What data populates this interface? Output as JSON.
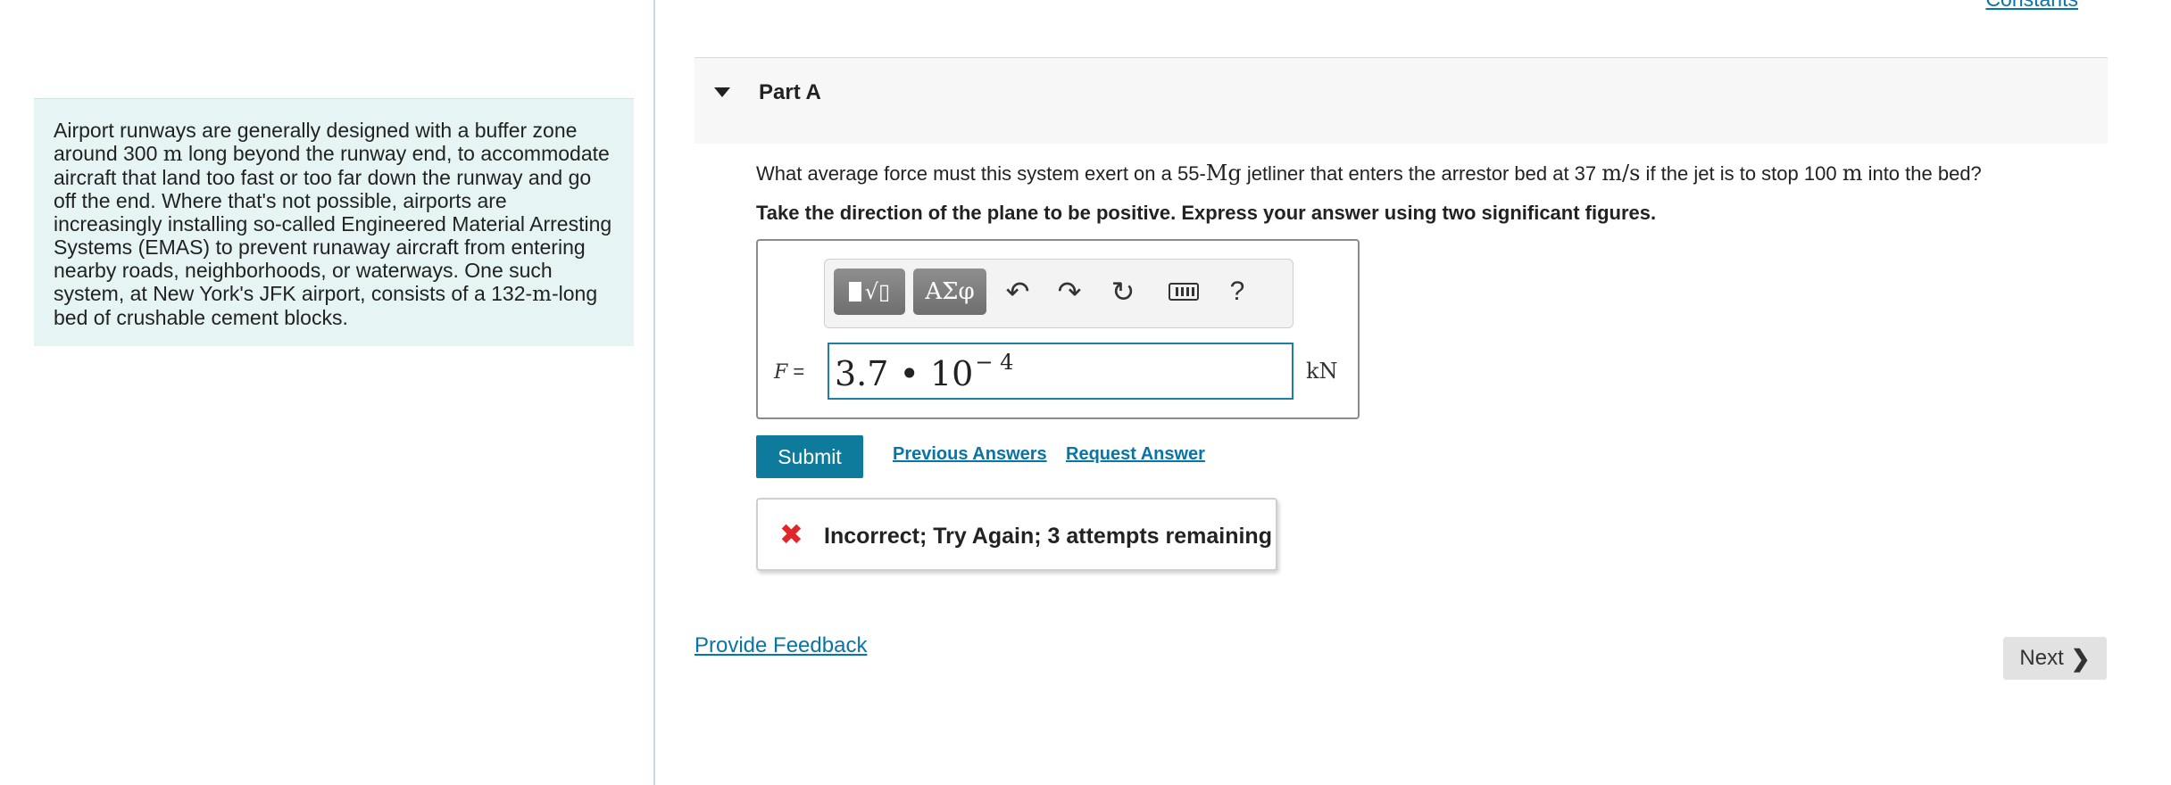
{
  "intro": {
    "segments": [
      {
        "text": "Airport runways are generally designed with a buffer zone around 300 ",
        "math": false
      },
      {
        "text": "m",
        "math": true
      },
      {
        "text": " long beyond the runway end, to accommodate aircraft that land too fast or too far down the runway and go off the end. Where that's not possible, airports are increasingly installing so-called Engineered Material Arresting Systems (EMAS) to prevent runaway aircraft from entering nearby roads, neighborhoods, or waterways. One such system, at New York's JFK airport, consists of a 132-",
        "math": false
      },
      {
        "text": "m",
        "math": true
      },
      {
        "text": "-long bed of crushable cement blocks.",
        "math": false
      }
    ]
  },
  "header": {
    "constants_link": "Constants"
  },
  "part": {
    "title": "Part A"
  },
  "question": {
    "segments": [
      {
        "text": "What average force must this system exert on a 55-",
        "math": false
      },
      {
        "text": "Mg",
        "math": true
      },
      {
        "text": " jetliner that enters the arrestor bed at 37 ",
        "math": false
      },
      {
        "text": "m/s",
        "math": true
      },
      {
        "text": " if the jet is to stop 100 ",
        "math": false
      },
      {
        "text": "m",
        "math": true
      },
      {
        "text": " into the bed?",
        "math": false
      }
    ],
    "instruction": "Take the direction of the plane to be positive. Express your answer using two significant figures."
  },
  "toolbar": {
    "greek_label": "ΑΣφ",
    "help_label": "?",
    "icons": [
      "templates-icon",
      "greek-letters-icon",
      "undo-icon",
      "redo-icon",
      "reset-icon",
      "keyboard-icon",
      "help-icon"
    ]
  },
  "answer": {
    "variable": "F",
    "equals": "=",
    "mantissa": "3.7 • 10",
    "exponent": "− 4",
    "unit": "kN"
  },
  "actions": {
    "submit_label": "Submit",
    "previous_answers_label": "Previous Answers",
    "request_answer_label": "Request Answer"
  },
  "feedback": {
    "icon": "x-icon",
    "message": "Incorrect; Try Again; 3 attempts remaining",
    "color": "#e0262a"
  },
  "footer": {
    "provide_feedback_label": "Provide Feedback",
    "next_label": "Next"
  },
  "colors": {
    "accent": "#0e7a9c",
    "link": "#0a74a6",
    "intro_bg": "#e6f5f4",
    "error": "#e0262a"
  }
}
